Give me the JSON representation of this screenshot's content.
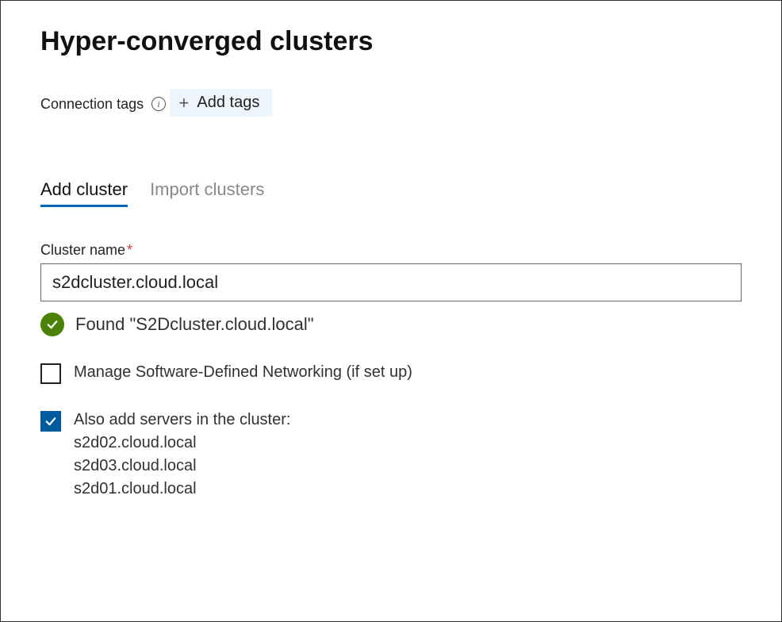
{
  "title": "Hyper-converged clusters",
  "connectionTags": {
    "label": "Connection tags",
    "addButton": "Add tags"
  },
  "tabs": {
    "addCluster": "Add cluster",
    "importClusters": "Import clusters"
  },
  "clusterName": {
    "label": "Cluster name",
    "value": "s2dcluster.cloud.local"
  },
  "status": {
    "message": "Found \"S2Dcluster.cloud.local\""
  },
  "sdn": {
    "label": "Manage Software-Defined Networking (if set up)"
  },
  "addServers": {
    "label": "Also add servers in the cluster:",
    "items": [
      "s2d02.cloud.local",
      "s2d03.cloud.local",
      "s2d01.cloud.local"
    ]
  }
}
